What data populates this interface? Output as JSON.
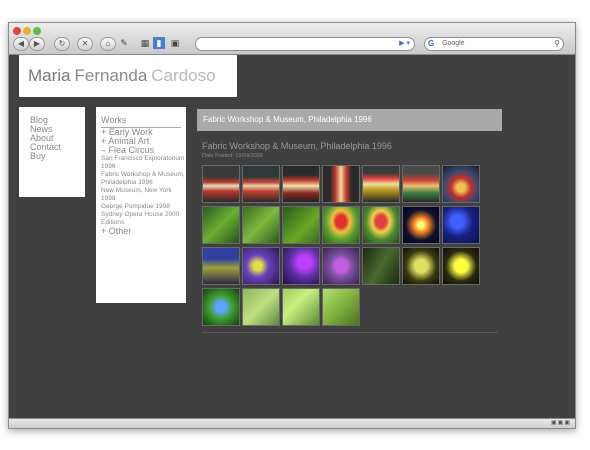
{
  "browser": {
    "search_placeholder": "Google",
    "search_engine_letter": "G",
    "icons": [
      "back-icon",
      "forward-icon",
      "reload-icon",
      "stop-icon",
      "home-icon",
      "bookmark-icon",
      "tabs-icon",
      "rss-icon"
    ]
  },
  "site": {
    "title_first": "Maria",
    "title_middle": "Fernanda",
    "title_last": "Cardoso"
  },
  "nav": {
    "items": [
      "Blog",
      "News",
      "About",
      "Contact",
      "Buy"
    ]
  },
  "works": {
    "heading": "Works",
    "items": [
      {
        "label": "+ Early Work",
        "type": "major"
      },
      {
        "label": "+ Animal Art",
        "type": "major"
      },
      {
        "label": "– Flea Circus",
        "type": "major"
      },
      {
        "label": "San Francisco Exploratorium 1996",
        "type": "minor"
      },
      {
        "label": "Fabric Workshop & Museum, Philadelphia 1996",
        "type": "minor"
      },
      {
        "label": "New Museum, New York 1998",
        "type": "minor"
      },
      {
        "label": "George Pompidue 1998",
        "type": "minor"
      },
      {
        "label": "Sydney Opera House 2000",
        "type": "minor"
      },
      {
        "label": "Editions",
        "type": "minor"
      },
      {
        "label": "+ Other",
        "type": "major"
      }
    ]
  },
  "main": {
    "banner": "Fabric Workshop & Museum, Philadelphia 1996",
    "post_title": "Fabric Workshop & Museum, Philadelphia 1996",
    "post_date": "Date Posted: 19/04/2009",
    "thumbnails": [
      {
        "bg": "linear-gradient(#3a3a3a 30%, #b9372c 45%, #e8e0c0 55%, #b9372c 70%, #2a2a2a)"
      },
      {
        "bg": "linear-gradient(#2e3a3a 30%, #c9413a 45%, #e6d6a8 55%, #c24030 70%, #2a2a2a)"
      },
      {
        "bg": "linear-gradient(#2a2a2a 25%, #c23c30 40%, #f0e2b0 55%, #8a2a20 75%, #222)"
      },
      {
        "bg": "linear-gradient(90deg, #2a2a2a 20%, #c03a32 35%, #f0d89a 50%, #c03a32 65%, #2a2a2a 80%)"
      },
      {
        "bg": "linear-gradient(#3a3a3a 20%, #e04040 35%, #f0e0a0 50%, #c0a020 65%, #2a2a2a)"
      },
      {
        "bg": "linear-gradient(#4a4a4a 20%, #d04038 40%, #e8c070 55%, #3a8040 75%, #2a2a2a)"
      },
      {
        "bg": "radial-gradient(circle at 50% 60%, #f0c050 15%, #c03030 35%, #3a4a70 60%, #1a1a2a)"
      },
      {
        "bg": "linear-gradient(135deg, #2a5a20, #6ab030 50%, #2a5020)"
      },
      {
        "bg": "linear-gradient(135deg, #3a6a20, #7fb840 50%, #2a5a1a)"
      },
      {
        "bg": "linear-gradient(135deg, #2a5a1a, #6aa828 60%, #3a6a20)"
      },
      {
        "bg": "radial-gradient(ellipse at 50% 40%, #e03030 20%, #f0c040 35%, #5aa030 60%, #2a5a1a)"
      },
      {
        "bg": "radial-gradient(ellipse at 50% 40%, #e04040 20%, #f0d050 35%, #4a8a30 60%, #2a4a1a)"
      },
      {
        "bg": "radial-gradient(circle at 50% 50%, #ffff80 10%, #f08020 30%, #101030 60%, #050520)"
      },
      {
        "bg": "radial-gradient(circle at 40% 40%, #4060ff 20%, #1a2080 50%, #0a1050)"
      },
      {
        "bg": "linear-gradient(#3040a0 30%, #a0a040 55%, #2a2a40)"
      },
      {
        "bg": "radial-gradient(circle at 40% 50%, #e0e040 15%, #6a40c0 40%, #2a1a50)"
      },
      {
        "bg": "radial-gradient(circle at 60% 40%, #c040ff 20%, #5a30a0 50%, #1a1040)"
      },
      {
        "bg": "radial-gradient(circle at 50% 50%, #c060e0 25%, #7a50a0 45%, #3a2050)"
      },
      {
        "bg": "linear-gradient(120deg, #1a2a10, #4a6a30 50%, #1a2a10)"
      },
      {
        "bg": "radial-gradient(circle at 50% 50%, #e0e060 25%, #3a3a10 60%, #101005)"
      },
      {
        "bg": "radial-gradient(circle at 50% 50%, #ffff40 25%, #2a2a10 60%, #101005)"
      },
      {
        "bg": "radial-gradient(circle at 50% 50%, #60a0ff 20%, #40a030 45%, #104010)"
      },
      {
        "bg": "linear-gradient(135deg, #8ab860, #c0e080 50%, #5a8a40)"
      },
      {
        "bg": "linear-gradient(135deg, #a0d060, #c8f080 40%, #5a8a30)"
      },
      {
        "bg": "linear-gradient(135deg, #b0e070, #80b040 50%, #4a7020)"
      }
    ]
  }
}
